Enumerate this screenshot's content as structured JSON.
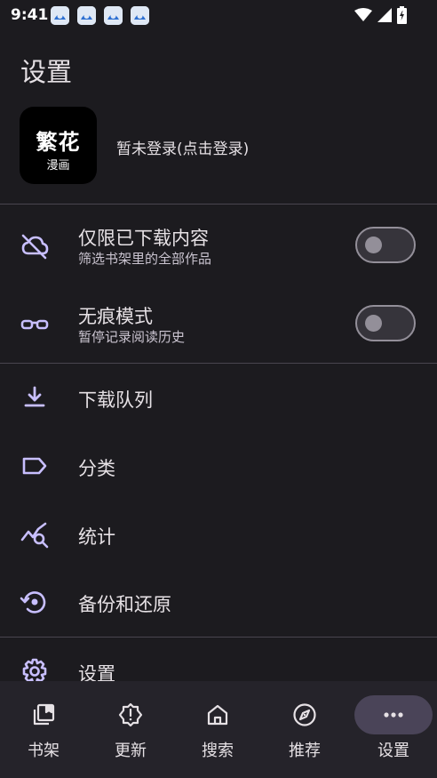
{
  "status_bar": {
    "time": "9:41",
    "notification_icons": [
      "app-notification-icon",
      "app-notification-icon",
      "app-notification-icon",
      "app-notification-icon"
    ],
    "system_icons": [
      "wifi-icon",
      "cellular-signal-icon",
      "battery-charging-icon"
    ]
  },
  "page": {
    "title": "设置"
  },
  "account": {
    "logo_text_main": "繁花",
    "logo_text_sub": "漫画",
    "login_label": "暂未登录(点击登录)"
  },
  "settings": {
    "downloaded_only": {
      "title": "仅限已下载内容",
      "subtitle": "筛选书架里的全部作品",
      "enabled": false,
      "icon": "cloud-off-icon"
    },
    "incognito": {
      "title": "无痕模式",
      "subtitle": "暂停记录阅读历史",
      "enabled": false,
      "icon": "glasses-icon"
    },
    "menu_items": [
      {
        "label": "下载队列",
        "icon": "download-icon"
      },
      {
        "label": "分类",
        "icon": "label-icon"
      },
      {
        "label": "统计",
        "icon": "stats-icon"
      },
      {
        "label": "备份和还原",
        "icon": "restore-icon"
      },
      {
        "label": "设置",
        "icon": "gear-icon"
      }
    ]
  },
  "bottom_nav": {
    "items": [
      {
        "label": "书架",
        "icon": "library-icon",
        "active": false
      },
      {
        "label": "更新",
        "icon": "updates-icon",
        "active": false
      },
      {
        "label": "搜索",
        "icon": "home-icon",
        "active": false
      },
      {
        "label": "推荐",
        "icon": "compass-icon",
        "active": false
      },
      {
        "label": "设置",
        "icon": "more-icon",
        "active": true
      }
    ]
  },
  "colors": {
    "background": "#1c1b1f",
    "accent_icon": "#c8bfff",
    "text_primary": "#e6e1e5",
    "text_secondary": "#cac4d0",
    "nav_background": "#25232a",
    "nav_active_indicator": "#4a4458"
  }
}
